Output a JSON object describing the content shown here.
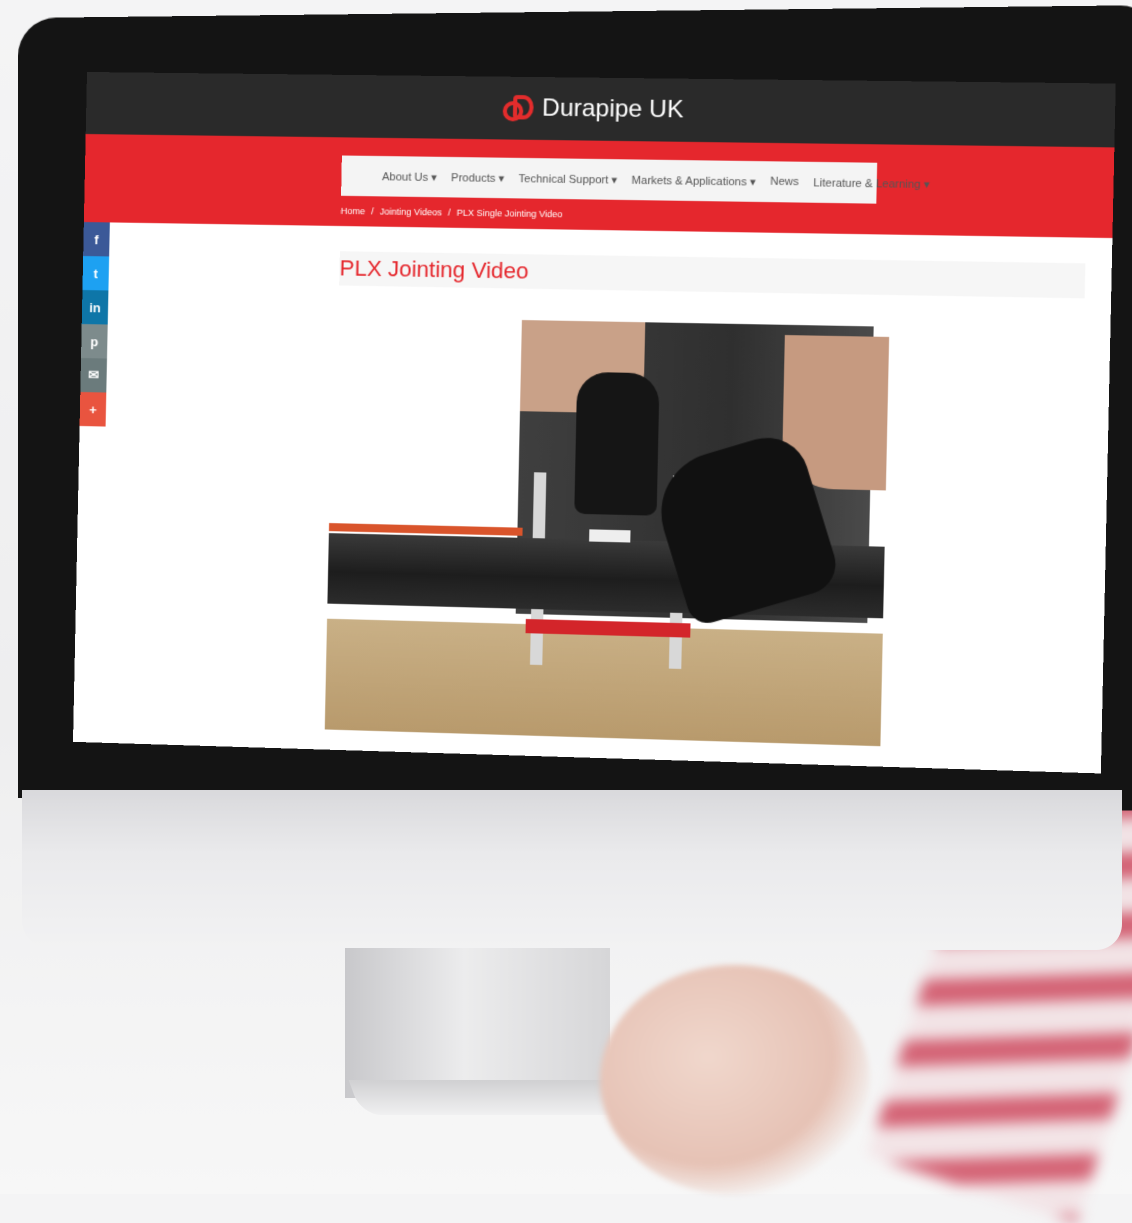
{
  "site": {
    "brand_name": "Durapipe UK",
    "brand_color": "#e5272d"
  },
  "nav": {
    "items": [
      {
        "label": "About Us"
      },
      {
        "label": "Products"
      },
      {
        "label": "Technical Support"
      },
      {
        "label": "Markets & Applications"
      },
      {
        "label": "News"
      },
      {
        "label": "Literature & Learning"
      }
    ]
  },
  "breadcrumb": {
    "items": [
      "Home",
      "/",
      "Jointing Videos",
      "/",
      "PLX Single Jointing Video"
    ]
  },
  "page": {
    "title": "PLX Jointing Video"
  },
  "share": {
    "buttons": [
      {
        "icon": "facebook-icon",
        "glyph": "f",
        "color": "#3b5998"
      },
      {
        "icon": "twitter-icon",
        "glyph": "t",
        "color": "#1da1f2"
      },
      {
        "icon": "linkedin-icon",
        "glyph": "in",
        "color": "#0e76a8"
      },
      {
        "icon": "pinterest-icon",
        "glyph": "p",
        "color": "#7d8b8c"
      },
      {
        "icon": "email-icon",
        "glyph": "✉",
        "color": "#6b7b7c"
      },
      {
        "icon": "more-icon",
        "glyph": "+",
        "color": "#e9543f"
      }
    ]
  }
}
